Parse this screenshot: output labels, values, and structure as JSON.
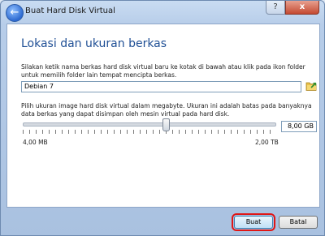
{
  "window": {
    "title": "Buat Hard Disk Virtual",
    "controls": {
      "help": "?",
      "close": "x"
    },
    "back_icon": "back-arrow-icon"
  },
  "page": {
    "heading": "Lokasi dan ukuran berkas",
    "location_description": "Silakan ketik nama berkas hard disk virtual baru ke kotak di bawah atau klik pada ikon folder untuk memilih folder lain tempat mencipta berkas.",
    "file_name": "Debian 7",
    "size_description": "Pilih ukuran image hard disk virtual dalam megabyte. Ukuran ini adalah batas pada banyaknya data berkas yang dapat disimpan oleh mesin virtual pada hard disk.",
    "size_value": "8,00 GB",
    "slider_min_label": "4,00 MB",
    "slider_max_label": "2,00 TB",
    "slider_position_fraction": 0.57
  },
  "buttons": {
    "create": "Buat",
    "cancel": "Batal"
  },
  "colors": {
    "heading": "#1f4f95",
    "highlight_box": "#e01616"
  }
}
